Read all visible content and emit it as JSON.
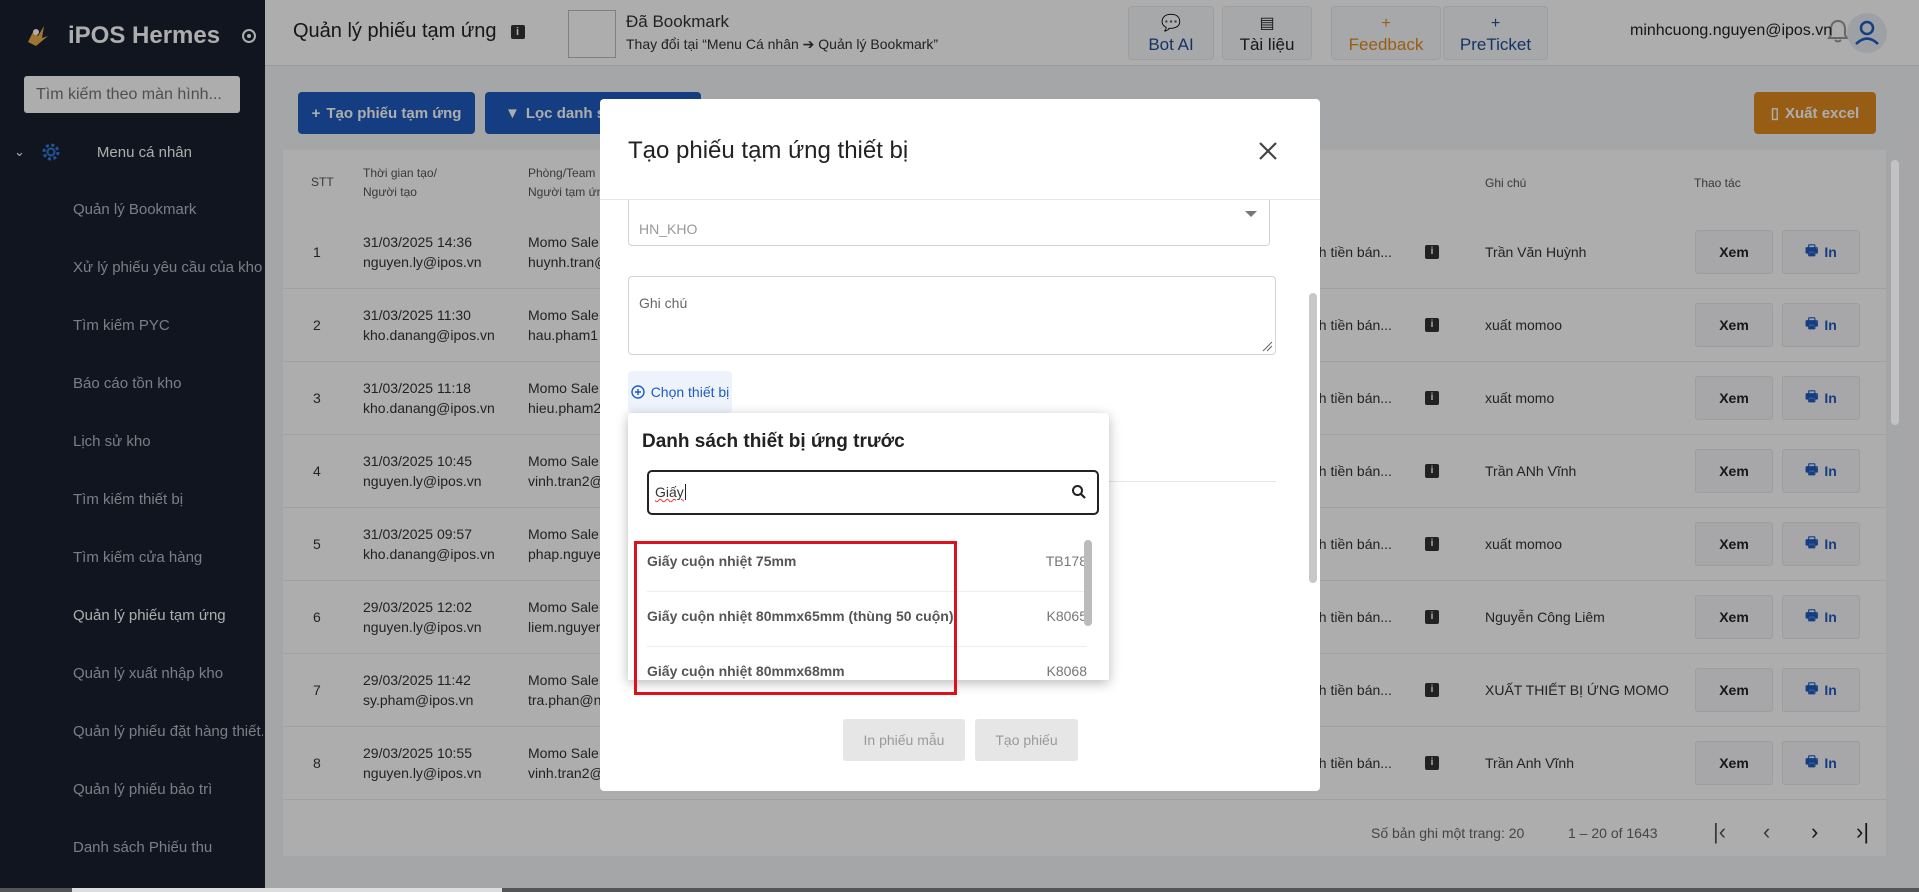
{
  "app": {
    "brand": "iPOS Hermes",
    "search_placeholder": "Tìm kiếm theo màn hình...",
    "menu_root": "Menu cá nhân",
    "menu_items": [
      "Quản lý Bookmark",
      "Xử lý phiếu yêu cầu của kho",
      "Tìm kiếm PYC",
      "Báo cáo tồn kho",
      "Lịch sử kho",
      "Tìm kiếm thiết bị",
      "Tìm kiếm cửa hàng",
      "Quản lý phiếu tạm ứng",
      "Quản lý xuất nhập kho",
      "Quản lý phiếu đặt hàng thiết...",
      "Quản lý phiếu bảo trì",
      "Danh sách Phiếu thu"
    ],
    "active_menu_index": 7
  },
  "header": {
    "page_title": "Quản lý phiếu tạm ứng",
    "bookmark_title": "Đã Bookmark",
    "bookmark_sub": "Thay đổi tại “Menu Cá nhân ➔ Quản lý Bookmark”",
    "buttons": {
      "bot_ai": "Bot AI",
      "tai_lieu": "Tài liệu",
      "feedback": "Feedback",
      "preticket": "PreTicket"
    },
    "user_email": "minhcuong.nguyen@ipos.vn"
  },
  "toolbar": {
    "create_label": "Tạo phiếu tạm ứng",
    "filter_label": "Lọc danh sá",
    "export_label": "Xuất excel"
  },
  "table": {
    "headers": {
      "stt": "STT",
      "time_line1": "Thời gian tạo/",
      "time_line2": "Người tạo",
      "team_line1": "Phòng/Team",
      "team_line2": "Người tạm ứn",
      "note": "Ghi chú",
      "action": "Thao tác"
    },
    "rows": [
      {
        "stt": "1",
        "time": "31/03/2025 14:36",
        "creator": "nguyen.ly@ipos.vn",
        "team": "Momo Sale",
        "person": "huynh.tran@",
        "content": "nh tiền bán...",
        "note": "Trần Văn Huỳnh"
      },
      {
        "stt": "2",
        "time": "31/03/2025 11:30",
        "creator": "kho.danang@ipos.vn",
        "team": "Momo Sale",
        "person": "hau.pham1",
        "content": "nh tiền bán...",
        "note": "xuất momoo"
      },
      {
        "stt": "3",
        "time": "31/03/2025 11:18",
        "creator": "kho.danang@ipos.vn",
        "team": "Momo Sale",
        "person": "hieu.pham2",
        "content": "nh tiền bán...",
        "note": "xuất momo"
      },
      {
        "stt": "4",
        "time": "31/03/2025 10:45",
        "creator": "nguyen.ly@ipos.vn",
        "team": "Momo Sale",
        "person": "vinh.tran2@",
        "content": "nh tiền bán...",
        "note": "Trần ANh Vĩnh"
      },
      {
        "stt": "5",
        "time": "31/03/2025 09:57",
        "creator": "kho.danang@ipos.vn",
        "team": "Momo Sale",
        "person": "phap.nguye",
        "content": "nh tiền bán...",
        "note": "xuất momoo"
      },
      {
        "stt": "6",
        "time": "29/03/2025 12:02",
        "creator": "nguyen.ly@ipos.vn",
        "team": "Momo Sale",
        "person": "liem.nguyer",
        "content": "nh tiền bán...",
        "note": "Nguyễn Công Liêm"
      },
      {
        "stt": "7",
        "time": "29/03/2025 11:42",
        "creator": "sy.pham@ipos.vn",
        "team": "Momo Sale",
        "person": "tra.phan@n",
        "content": "nh tiền bán...",
        "note": "XUẤT THIẾT BỊ ỨNG MOMO"
      },
      {
        "stt": "8",
        "time": "29/03/2025 10:55",
        "creator": "nguyen.ly@ipos.vn",
        "team": "Momo Sale",
        "person": "vinh.tran2@",
        "content": "nh tiền bán...",
        "note": "Trần Anh Vĩnh"
      }
    ],
    "view_label": "Xem",
    "print_label": "In",
    "rows_per_page_label": "Số bản ghi một trang: 20",
    "range_label": "1 – 20 of 1643"
  },
  "modal": {
    "title": "Tạo phiếu tạm ứng thiết bị",
    "warehouse_value": "HN_KHO",
    "note_placeholder": "Ghi chú",
    "choose_device_label": "Chọn thiết bị",
    "print_sample_label": "In phiếu mẫu",
    "create_label": "Tạo phiếu"
  },
  "device_panel": {
    "title": "Danh sách thiết bị ứng trước",
    "search_value": "Giấy",
    "results": [
      {
        "name": "Giấy cuộn nhiệt 75mm",
        "code": "TB178"
      },
      {
        "name": "Giấy cuộn nhiệt 80mmx65mm (thùng 50 cuộn)",
        "code": "K8065"
      },
      {
        "name": "Giấy cuộn nhiệt 80mmx68mm",
        "code": "K8068"
      }
    ]
  },
  "colors": {
    "sidebar_bg": "#1a2030",
    "primary": "#1f5bbf",
    "export": "#e08a1e",
    "highlight": "#e0101a"
  }
}
